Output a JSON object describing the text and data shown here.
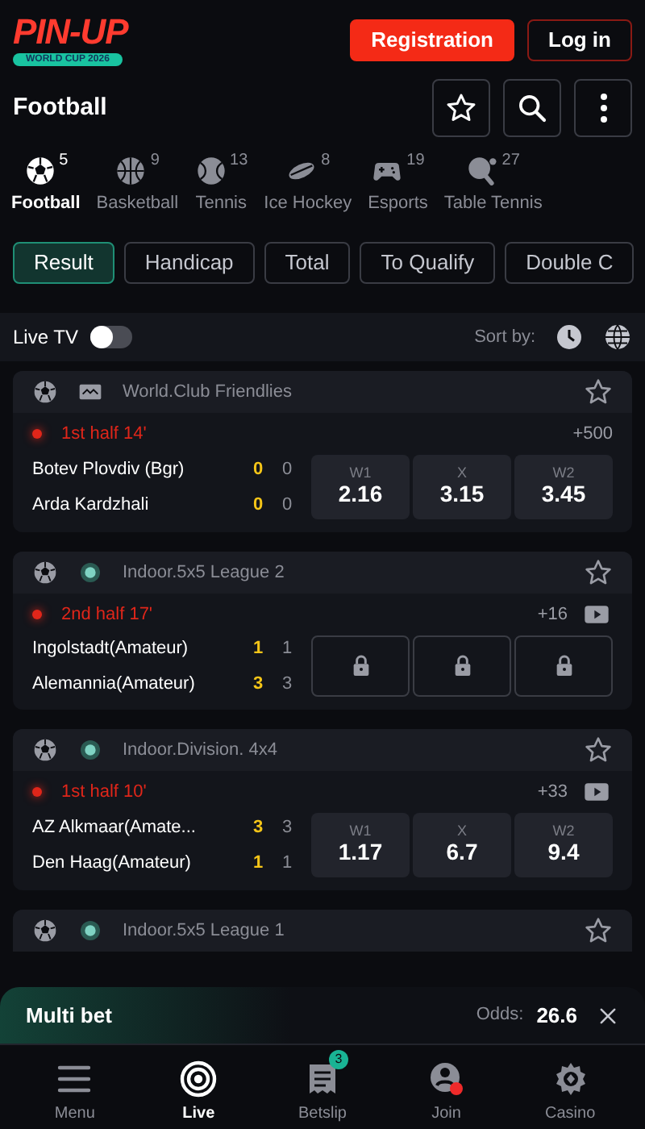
{
  "header": {
    "logo": {
      "text": "PIN-UP",
      "subtitle": "WORLD CUP 2026"
    },
    "buttons": [
      {
        "kind": "primary",
        "label": "Registration"
      },
      {
        "kind": "outline",
        "label": "Log in"
      }
    ]
  },
  "title_bar": {
    "title": "Football",
    "actions": [
      {
        "kind": "star"
      },
      {
        "kind": "search"
      },
      {
        "kind": "more"
      }
    ]
  },
  "sport_tabs": [
    {
      "kind": "football",
      "label": "Football",
      "count": "5",
      "selected": true
    },
    {
      "kind": "basketball",
      "label": "Basketball",
      "count": "9",
      "selected": false
    },
    {
      "kind": "tennis",
      "label": "Tennis",
      "count": "13",
      "selected": false
    },
    {
      "kind": "hockey",
      "label": "Ice Hockey",
      "count": "8",
      "selected": false
    },
    {
      "kind": "esports",
      "label": "Esports",
      "count": "19",
      "selected": false
    },
    {
      "kind": "tabletennis",
      "label": "Table Tennis",
      "count": "27",
      "selected": false
    }
  ],
  "market_tabs": [
    {
      "label": "Result",
      "selected": true
    },
    {
      "label": "Handicap",
      "selected": false
    },
    {
      "label": "Total",
      "selected": false
    },
    {
      "label": "To Qualify",
      "selected": false
    },
    {
      "label": "Double C",
      "selected": false
    }
  ],
  "filter_bar": {
    "live_tv": {
      "label": "Live TV",
      "on": false
    },
    "sort_label": "Sort by:"
  },
  "events": [
    {
      "kind": "tv",
      "league": "World.Club Friendlies",
      "favorite": false,
      "status": "1st half 14'",
      "more": "+500",
      "video": false,
      "teams": [
        {
          "name": "Botev Plovdiv (Bgr)",
          "score": "0",
          "score_2": "0"
        },
        {
          "name": "Arda Kardzhali",
          "score": "0",
          "score_2": "0"
        }
      ],
      "odds": [
        {
          "label": "W1",
          "value": "2.16",
          "locked": false
        },
        {
          "label": "X",
          "value": "3.15",
          "locked": false
        },
        {
          "label": "W2",
          "value": "3.45",
          "locked": false
        }
      ]
    },
    {
      "kind": "dot",
      "league": "Indoor.5x5 League 2",
      "favorite": false,
      "status": "2nd half 17'",
      "more": "+16",
      "video": true,
      "teams": [
        {
          "name": "Ingolstadt(Amateur)",
          "score": "1",
          "score_2": "1"
        },
        {
          "name": "Alemannia(Amateur)",
          "score": "3",
          "score_2": "3"
        }
      ],
      "odds": [
        {
          "locked": true
        },
        {
          "locked": true
        },
        {
          "locked": true
        }
      ]
    },
    {
      "kind": "dot",
      "league": "Indoor.Division. 4x4",
      "favorite": false,
      "status": "1st half 10'",
      "more": "+33",
      "video": true,
      "teams": [
        {
          "name": "AZ Alkmaar(Amate...",
          "score": "3",
          "score_2": "3"
        },
        {
          "name": "Den Haag(Amateur)",
          "score": "1",
          "score_2": "1"
        }
      ],
      "odds": [
        {
          "label": "W1",
          "value": "1.17",
          "locked": false
        },
        {
          "label": "X",
          "value": "6.7",
          "locked": false
        },
        {
          "label": "W2",
          "value": "9.4",
          "locked": false
        }
      ]
    },
    {
      "kind": "dot",
      "league": "Indoor.5x5 League 1",
      "favorite": false
    }
  ],
  "multi_bet": {
    "label": "Multi bet",
    "odds_label": "Odds:",
    "odds": "26.6"
  },
  "bottom_nav": [
    {
      "kind": "menu",
      "label": "Menu",
      "selected": false
    },
    {
      "kind": "live",
      "label": "Live",
      "selected": true
    },
    {
      "kind": "betslip",
      "label": "Betslip",
      "badge": "3",
      "selected": false
    },
    {
      "kind": "join",
      "label": "Join",
      "selected": false
    },
    {
      "kind": "casino",
      "label": "Casino",
      "selected": false
    }
  ]
}
